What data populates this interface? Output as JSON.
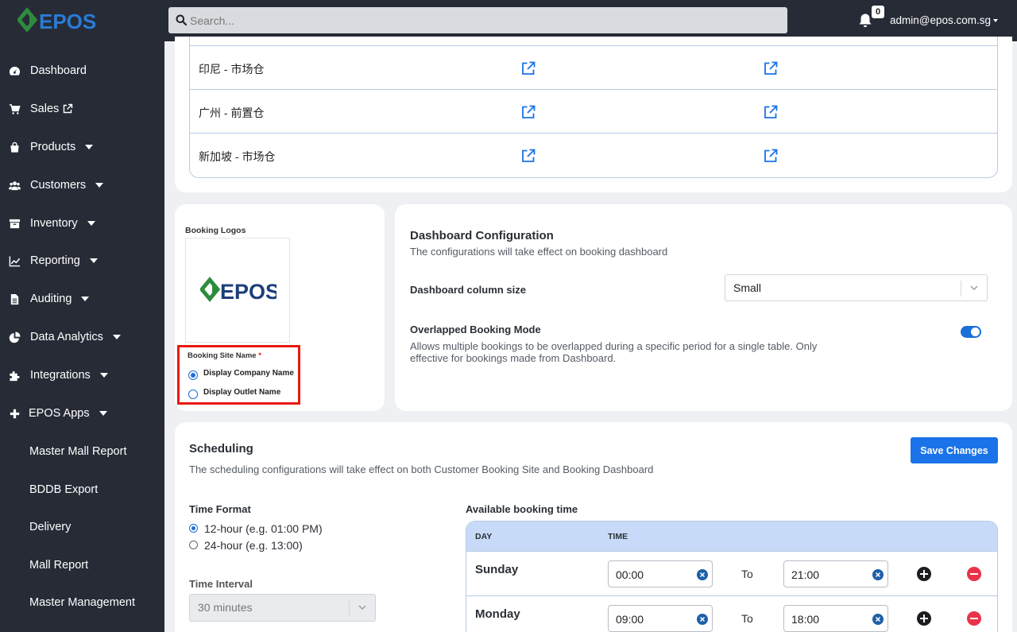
{
  "header": {
    "logo_text": "EPOS",
    "search_placeholder": "Search...",
    "notification_count": "0",
    "user_email": "admin@epos.com.sg"
  },
  "sidebar": {
    "items": [
      {
        "label": "Dashboard",
        "icon": "dashboard-icon"
      },
      {
        "label": "Sales",
        "icon": "cart-icon"
      },
      {
        "label": "Products",
        "icon": "bag-icon"
      },
      {
        "label": "Customers",
        "icon": "users-icon"
      },
      {
        "label": "Inventory",
        "icon": "archive-icon"
      },
      {
        "label": "Reporting",
        "icon": "chart-line-icon"
      },
      {
        "label": "Auditing",
        "icon": "file-icon"
      },
      {
        "label": "Data Analytics",
        "icon": "pie-chart-icon"
      },
      {
        "label": "Integrations",
        "icon": "puzzle-icon"
      },
      {
        "label": "EPOS Apps",
        "icon": "plus-icon"
      }
    ],
    "sub_items": [
      "Master Mall Report",
      "BDDB Export",
      "Delivery",
      "Mall Report",
      "Master Management"
    ]
  },
  "outlets": {
    "rows": [
      "印尼 - 市场仓",
      "广州 - 前置仓",
      "新加坡 - 市场仓"
    ]
  },
  "booking_logos": {
    "label": "Booking Logos",
    "logo_text": "EPOS",
    "site_name_label": "Booking Site Name",
    "required_mark": "*",
    "options": [
      "Display Company Name",
      "Display Outlet Name"
    ],
    "selected_index": 0
  },
  "dashboard_config": {
    "title": "Dashboard Configuration",
    "subtitle": "The configurations will take effect on booking dashboard",
    "column_size_label": "Dashboard column size",
    "column_size_value": "Small",
    "overlap_label": "Overlapped Booking Mode",
    "overlap_desc_1": "Allows multiple bookings to be overlapped during a specific period for a single table. Only",
    "overlap_desc_2": "effective for bookings made from Dashboard.",
    "overlap_enabled": true
  },
  "scheduling": {
    "title": "Scheduling",
    "subtitle": "The scheduling configurations will take effect on both Customer Booking Site and Booking Dashboard",
    "save_label": "Save Changes",
    "time_format_label": "Time Format",
    "time_format_options": [
      "12-hour (e.g. 01:00 PM)",
      "24-hour (e.g. 13:00)"
    ],
    "time_format_selected": 0,
    "interval_label": "Time Interval",
    "interval_value": "30 minutes",
    "available_label": "Available booking time",
    "col_day": "DAY",
    "col_time": "TIME",
    "to_label": "To",
    "rows": [
      {
        "day": "Sunday",
        "from": "00:00",
        "to": "21:00"
      },
      {
        "day": "Monday",
        "from": "09:00",
        "to": "18:00"
      }
    ]
  },
  "colors": {
    "sidebar_bg": "#262b36",
    "accent": "#1a73e8",
    "highlight": "#e8190f",
    "remove": "#e8334a"
  }
}
